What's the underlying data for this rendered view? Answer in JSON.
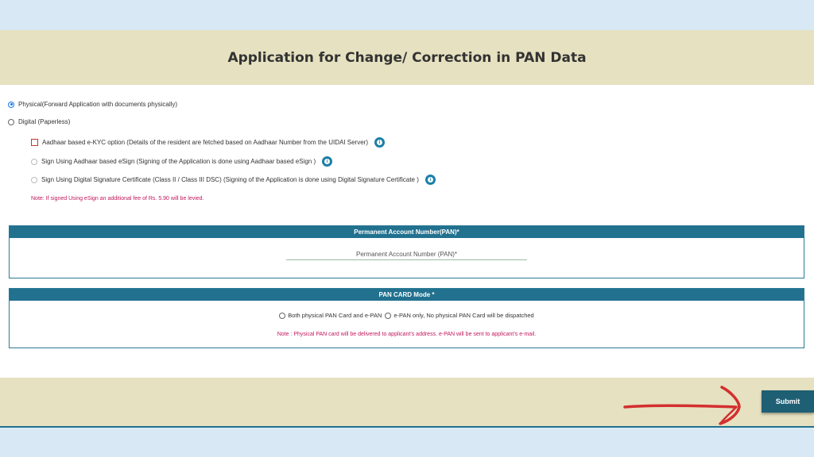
{
  "page_title": "Application for Change/ Correction in PAN Data",
  "application_mode": {
    "physical_label": "Physical(Forward Application with documents physically)",
    "digital_label": "Digital (Paperless)",
    "ekyc_label": "Aadhaar based e-KYC option (Details of the resident are fetched based on Aadhaar Number from the UIDAI Server)",
    "esign_label": "Sign Using Aadhaar based eSign (Signing of the Application is done using Aadhaar based eSign )",
    "dsc_label": "Sign Using Digital Signature Certificate (Class II / Class III DSC) (Signing of the Application is done using Digital Signature Certificate )",
    "note": "Note: If signed Using eSign an additional fee of Rs. 5.90 will be levied.",
    "selected": "physical"
  },
  "pan_section": {
    "header": "Permanent Account Number(PAN)*",
    "input_placeholder": "Permanent Account Number (PAN)*",
    "input_value": ""
  },
  "card_mode_section": {
    "header": "PAN CARD Mode *",
    "option_both": "Both physical PAN Card and e-PAN",
    "option_epan": "e-PAN only, No physical PAN Card will be dispatched",
    "note": "Note : Physical PAN card will be delivered to applicant’s address. e-PAN will be sent to applicant’s e-mail."
  },
  "submit_label": "Submit",
  "info_icon_glyph": "i",
  "colors": {
    "header_bg": "#e6e1c0",
    "panel_header_bg": "#21718f",
    "note_text": "#c2185b",
    "submit_bg": "#1e5f74",
    "annotation_arrow": "#d32f2f"
  }
}
